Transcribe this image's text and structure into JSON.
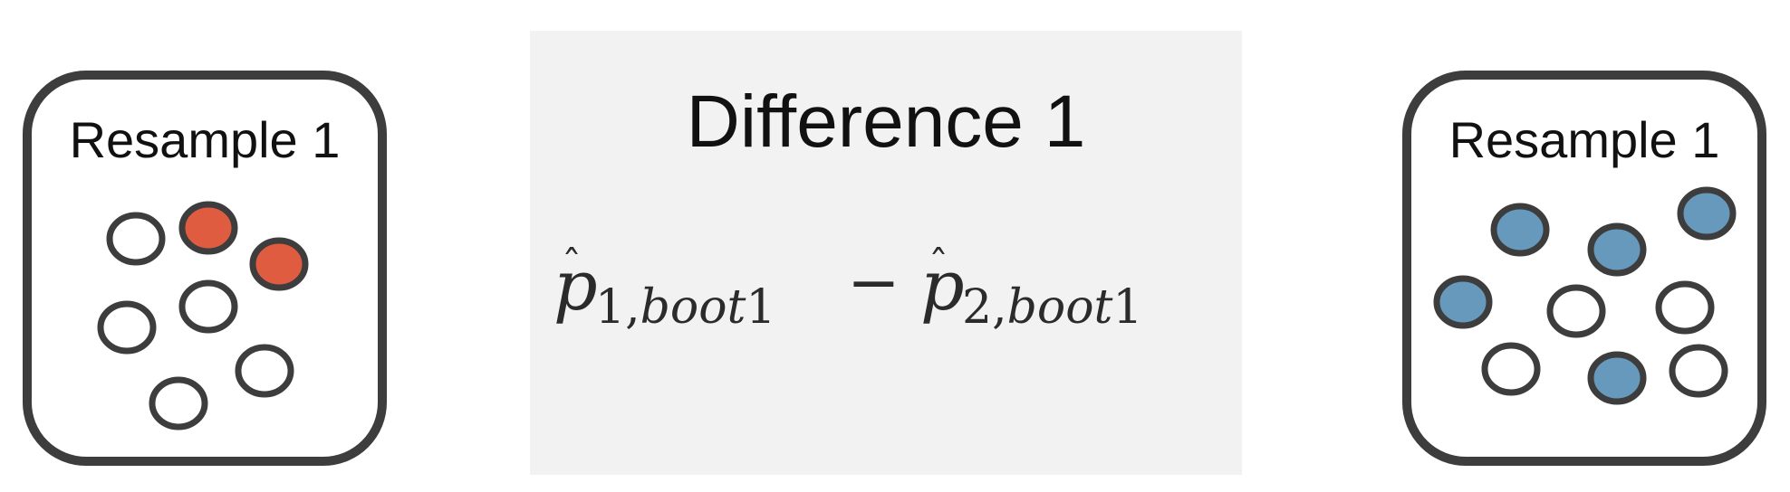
{
  "left_card": {
    "title": "Resample 1",
    "fill_color": "#e05c40",
    "dots": [
      {
        "filled": false
      },
      {
        "filled": true
      },
      {
        "filled": true
      },
      {
        "filled": false
      },
      {
        "filled": false
      },
      {
        "filled": false
      },
      {
        "filled": false
      }
    ]
  },
  "panel": {
    "title": "Difference 1",
    "formula": {
      "term1_symbol": "p",
      "term1_subscript": "1,",
      "term1_subscript_italic": "boot",
      "term1_subscript_end": "1",
      "operator": "−",
      "term2_symbol": "p",
      "term2_subscript": "2,",
      "term2_subscript_italic": "boot",
      "term2_subscript_end": "1"
    }
  },
  "right_card": {
    "title": "Resample 1",
    "fill_color": "#6699bb",
    "dots": [
      {
        "filled": true
      },
      {
        "filled": true
      },
      {
        "filled": true
      },
      {
        "filled": true
      },
      {
        "filled": false
      },
      {
        "filled": false
      },
      {
        "filled": false
      },
      {
        "filled": true
      },
      {
        "filled": false
      }
    ]
  }
}
